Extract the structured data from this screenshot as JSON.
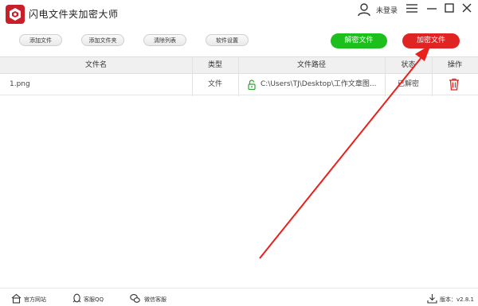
{
  "app": {
    "title": "闪电文件夹加密大师"
  },
  "header": {
    "login_label": "未登录"
  },
  "toolbar": {
    "add_file": "添加文件",
    "add_folder": "添加文件夹",
    "clear_list": "清除列表",
    "settings": "软件设置",
    "decrypt": "解密文件",
    "encrypt": "加密文件"
  },
  "table": {
    "columns": [
      "文件名",
      "类型",
      "文件路径",
      "状态",
      "操作"
    ],
    "rows": [
      {
        "name": "1.png",
        "type": "文件",
        "path": "C:\\Users\\TJ\\Desktop\\工作文章图...",
        "status": "已解密"
      }
    ]
  },
  "footer": {
    "website": "官方网站",
    "qq": "客服QQ",
    "wechat": "微信客服",
    "version": "版本：v2.8.1"
  },
  "colors": {
    "decrypt": "#1cbf1c",
    "encrypt": "#e02323",
    "arrow": "#e8211c",
    "lock": "#2ca52c"
  }
}
